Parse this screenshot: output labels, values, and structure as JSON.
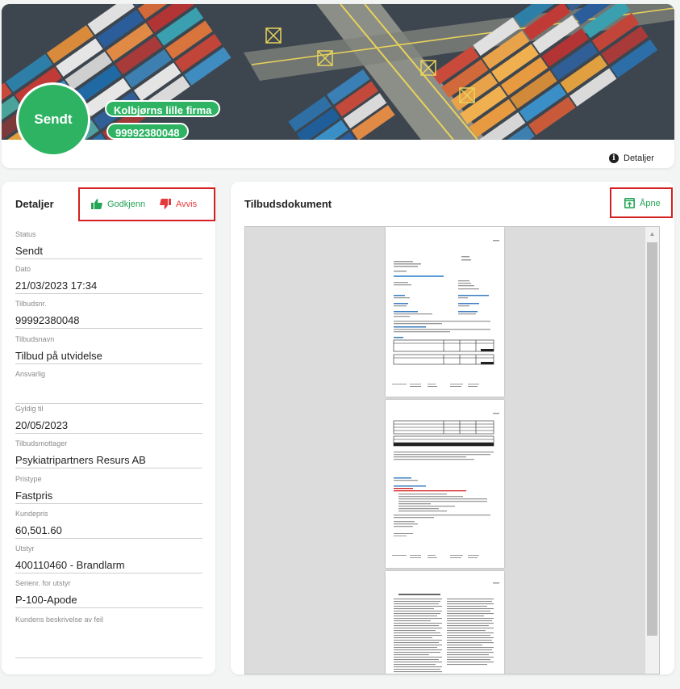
{
  "header": {
    "status_badge": "Sendt",
    "company_chip": "Kolbjørns lille firma",
    "phone_chip": "99992380048",
    "tab_details": "Detaljer"
  },
  "details": {
    "title": "Detaljer",
    "approve_label": "Godkjenn",
    "reject_label": "Avvis",
    "fields": [
      {
        "label": "Status",
        "value": "Sendt"
      },
      {
        "label": "Dato",
        "value": "21/03/2023  17:34"
      },
      {
        "label": "Tilbudsnr.",
        "value": "99992380048"
      },
      {
        "label": "Tilbudsnavn",
        "value": "Tilbud på utvidelse"
      },
      {
        "label": "Ansvarlig",
        "value": ""
      },
      {
        "label": "Gyldig til",
        "value": "20/05/2023"
      },
      {
        "label": "Tilbudsmottager",
        "value": "Psykiatripartners Resurs AB"
      },
      {
        "label": "Pristype",
        "value": "Fastpris"
      },
      {
        "label": "Kundepris",
        "value": "60,501.60"
      },
      {
        "label": "Utstyr",
        "value": "400110460 - Brandlarm"
      },
      {
        "label": "Serienr. for utstyr",
        "value": "P-100-Apode"
      },
      {
        "label": "Kundens beskrivelse av feil",
        "value": ""
      }
    ]
  },
  "document": {
    "title": "Tilbudsdokument",
    "open_label": "Åpne"
  },
  "colors": {
    "accent_green": "#2eb363",
    "reject_red": "#e5383b",
    "highlight_red": "#d42020"
  },
  "icons": {
    "approve": "thumbs-up-icon",
    "reject": "thumbs-down-icon",
    "open": "open-external-icon",
    "details_tab": "info-icon"
  }
}
